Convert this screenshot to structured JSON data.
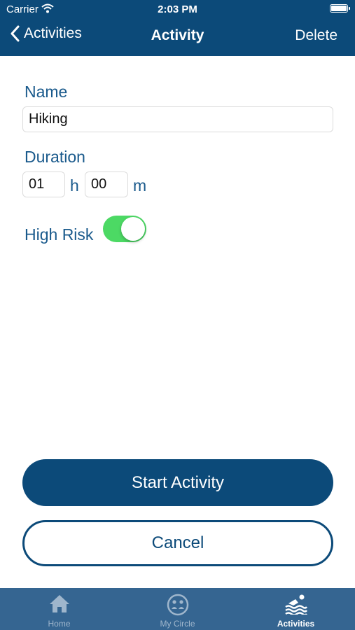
{
  "status_bar": {
    "carrier": "Carrier",
    "time": "2:03 PM"
  },
  "nav": {
    "back_label": "Activities",
    "title": "Activity",
    "delete_label": "Delete"
  },
  "form": {
    "name_label": "Name",
    "name_value": "Hiking",
    "duration_label": "Duration",
    "hours_value": "01",
    "hours_unit": "h",
    "minutes_value": "00",
    "minutes_unit": "m",
    "high_risk_label": "High Risk",
    "high_risk_on": true
  },
  "actions": {
    "start_label": "Start Activity",
    "cancel_label": "Cancel"
  },
  "tabbar": {
    "tabs": [
      {
        "label": "Home",
        "icon": "home-icon"
      },
      {
        "label": "My Circle",
        "icon": "circle-face-icon"
      },
      {
        "label": "Activities",
        "icon": "swimmer-icon",
        "active": true
      }
    ]
  },
  "colors": {
    "primary": "#0c4a79",
    "tabbar": "#356591",
    "label": "#1a5a8c",
    "toggle_on": "#4cd964"
  }
}
